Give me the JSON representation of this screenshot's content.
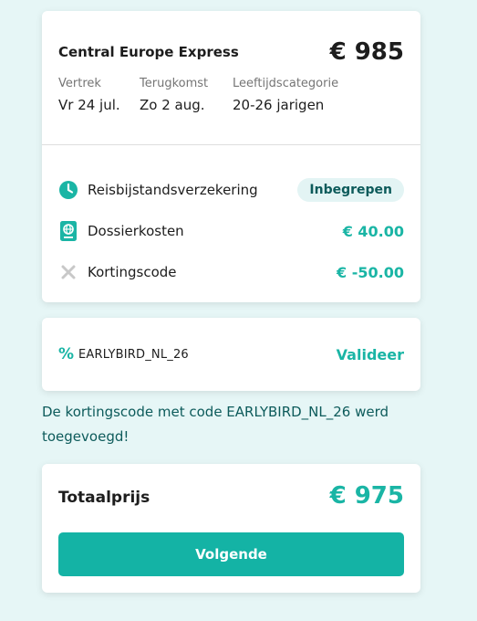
{
  "trip": {
    "name": "Central Europe Express",
    "price": "€ 985",
    "departure_label": "Vertrek",
    "departure_value": "Vr 24 jul.",
    "return_label": "Terugkomst",
    "return_value": "Zo 2 aug.",
    "age_label": "Leeftijdscategorie",
    "age_value": "20-26 jarigen"
  },
  "lines": [
    {
      "icon": "clock-icon",
      "label": "Reisbijstandsverzekering",
      "value": "Inbegrepen"
    },
    {
      "icon": "passport-icon",
      "label": "Dossierkosten",
      "value": "€ 40.00"
    },
    {
      "icon": "close-icon",
      "label": "Kortingscode",
      "value": "€ -50.00"
    }
  ],
  "discount": {
    "icon": "percent-icon",
    "code": "EARLYBIRD_NL_26",
    "validate_label": "Valideer",
    "success_message": "De kortingscode met code EARLYBIRD_NL_26 werd toegevoegd!"
  },
  "total": {
    "label": "Totaalprijs",
    "price": "€ 975",
    "next_label": "Volgende"
  },
  "colors": {
    "accent": "#1ab5a5",
    "button": "#14b3a5",
    "background": "#e6f6f6",
    "dark_teal": "#0d5b5b"
  }
}
